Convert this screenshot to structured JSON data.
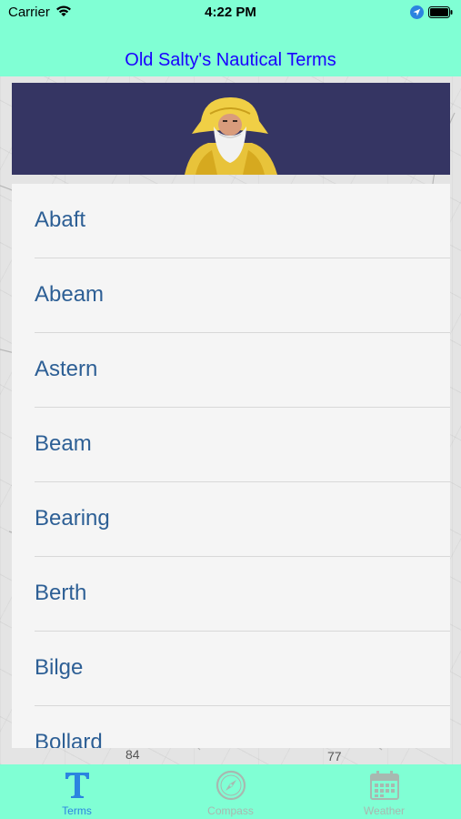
{
  "status": {
    "carrier": "Carrier",
    "time": "4:22 PM"
  },
  "nav": {
    "title": "Old Salty's Nautical Terms"
  },
  "terms": [
    {
      "label": "Abaft"
    },
    {
      "label": "Abeam"
    },
    {
      "label": "Astern"
    },
    {
      "label": "Beam"
    },
    {
      "label": "Bearing"
    },
    {
      "label": "Berth"
    },
    {
      "label": "Bilge"
    },
    {
      "label": "Bollard"
    }
  ],
  "map_labels": {
    "a": "84",
    "b": "77"
  },
  "tabs": [
    {
      "label": "Terms",
      "icon": "terms-icon",
      "active": true
    },
    {
      "label": "Compass",
      "icon": "compass-icon",
      "active": false
    },
    {
      "label": "Weather",
      "icon": "calendar-icon",
      "active": false
    }
  ],
  "colors": {
    "bar": "#80ffd4",
    "title": "#1a00ff",
    "banner": "#353563",
    "term_text": "#2d5f95",
    "tab_active": "#2b84e0"
  }
}
